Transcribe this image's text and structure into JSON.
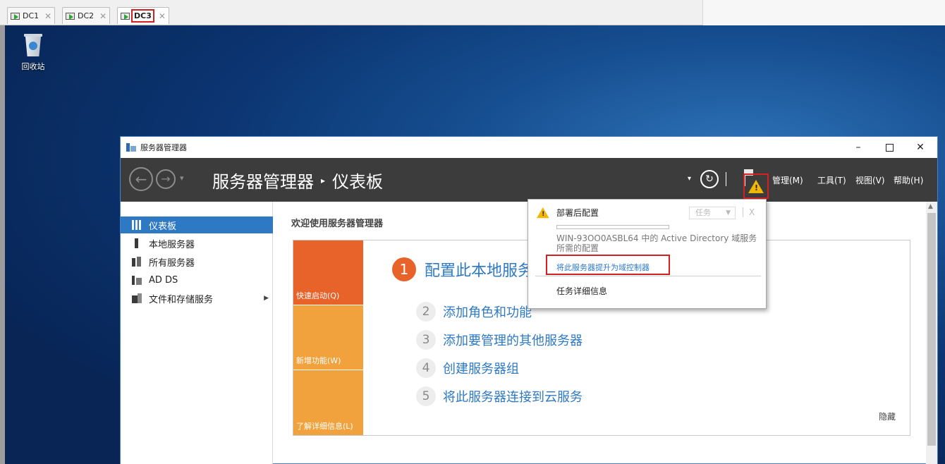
{
  "vm_tabs": [
    {
      "label": "DC1",
      "close": "✕"
    },
    {
      "label": "DC2",
      "close": "✕"
    },
    {
      "label": "DC3",
      "close": "✕"
    }
  ],
  "desktop": {
    "recycle_bin_label": "回收站"
  },
  "window": {
    "title": "服务器管理器",
    "minimize": "–",
    "close": "✕"
  },
  "header": {
    "back": "←",
    "forward": "→",
    "nav_dropdown": "▾",
    "breadcrumb_root": "服务器管理器",
    "breadcrumb_sep": "▸",
    "breadcrumb_page": "仪表板",
    "refresh_dropdown": "▾",
    "refresh": "↻",
    "warning_glyph": "!",
    "menus": [
      "管理(M)",
      "工具(T)",
      "视图(V)",
      "帮助(H)"
    ]
  },
  "sidebar": {
    "items": [
      {
        "label": "仪表板",
        "icon": "dashboard-icon"
      },
      {
        "label": "本地服务器",
        "icon": "server-icon"
      },
      {
        "label": "所有服务器",
        "icon": "servers-icon"
      },
      {
        "label": "AD DS",
        "icon": "ad-ds-icon"
      },
      {
        "label": "文件和存储服务",
        "icon": "file-storage-icon"
      }
    ],
    "expand_arrow": "▶"
  },
  "content": {
    "welcome_title": "欢迎使用服务器管理器",
    "tiles": [
      "快速启动(Q)",
      "新增功能(W)",
      "了解详细信息(L)"
    ],
    "steps": [
      {
        "num": "1",
        "label": "配置此本地服务器"
      },
      {
        "num": "2",
        "label": "添加角色和功能"
      },
      {
        "num": "3",
        "label": "添加要管理的其他服务器"
      },
      {
        "num": "4",
        "label": "创建服务器组"
      },
      {
        "num": "5",
        "label": "将此服务器连接到云服务"
      }
    ],
    "hide_link": "隐藏"
  },
  "notification": {
    "title": "部署后配置",
    "task_button": "任务",
    "task_dropdown": "▼",
    "close": "X",
    "progress_fraction": 0,
    "description": "WIN-93OO0ASBL64 中的 Active Directory 域服务所需的配置",
    "promote_link": "将此服务器提升为域控制器",
    "details_link": "任务详细信息"
  },
  "colors": {
    "accent_blue": "#2e79c4",
    "orange": "#e8632a",
    "light_orange": "#f2a23c",
    "header_bg": "#3c3c3c",
    "highlight_red": "#d42020",
    "warning_yellow": "#f2b705"
  }
}
